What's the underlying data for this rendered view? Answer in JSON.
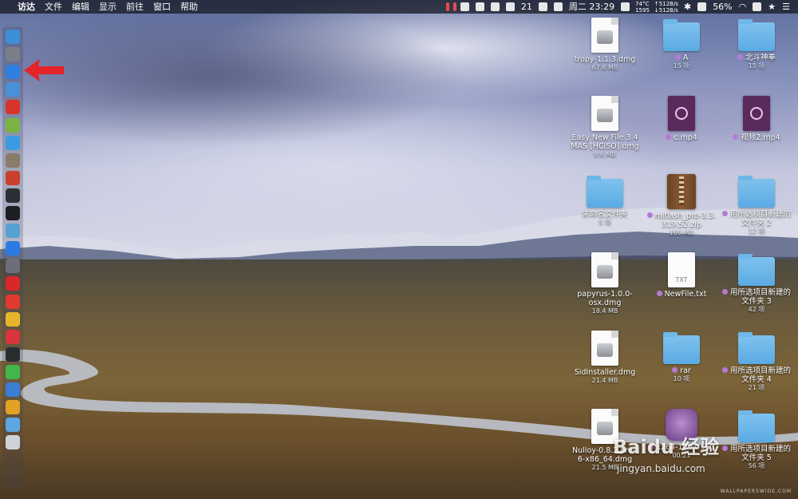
{
  "menubar": {
    "apple": "",
    "app_name": "访达",
    "menus": [
      "文件",
      "编辑",
      "显示",
      "前往",
      "窗口",
      "帮助"
    ],
    "status": {
      "wechat_count": "21",
      "datetime": "周二 23:29",
      "cpu_temp": "74°C",
      "fan_rpm": "1595",
      "net_up": "↑512B/s",
      "net_down": "↓512B/s",
      "battery": "56%"
    }
  },
  "dock": {
    "items": [
      {
        "name": "finder-icon",
        "color": "#3d8fd8",
        "glyph": ""
      },
      {
        "name": "launchpad-icon",
        "color": "#7b7f8a",
        "glyph": ""
      },
      {
        "name": "safari-icon",
        "color": "#2f7fe0",
        "glyph": ""
      },
      {
        "name": "contacts-icon",
        "color": "#4a90d9",
        "glyph": ""
      },
      {
        "name": "netease-icon",
        "color": "#d8342c",
        "glyph": ""
      },
      {
        "name": "android-icon",
        "color": "#7bb342",
        "glyph": ""
      },
      {
        "name": "migration-icon",
        "color": "#3a9ce0",
        "glyph": ""
      },
      {
        "name": "disk-icon",
        "color": "#8a7b6a",
        "glyph": ""
      },
      {
        "name": "music-icon",
        "color": "#c8402a",
        "glyph": ""
      },
      {
        "name": "activity-monitor-icon",
        "color": "#2b2f36",
        "glyph": ""
      },
      {
        "name": "terminal-icon",
        "color": "#1d1f22",
        "glyph": ""
      },
      {
        "name": "network-icon",
        "color": "#56a0d3",
        "glyph": ""
      },
      {
        "name": "app-store-icon",
        "color": "#2c7be5",
        "glyph": ""
      },
      {
        "name": "system-preferences-icon",
        "color": "#6b6f77",
        "glyph": ""
      },
      {
        "name": "weibo-icon",
        "color": "#d8282a",
        "glyph": ""
      },
      {
        "name": "yandex-icon",
        "color": "#e03a2e",
        "glyph": ""
      },
      {
        "name": "chrome-icon",
        "color": "#e8b52a",
        "glyph": ""
      },
      {
        "name": "vivaldi-icon",
        "color": "#d7363c",
        "glyph": ""
      },
      {
        "name": "terminal-alt-icon",
        "color": "#2a2d30",
        "glyph": ""
      },
      {
        "name": "wechat-icon",
        "color": "#44b549",
        "glyph": ""
      },
      {
        "name": "windows-vm-icon",
        "color": "#3a7fd4",
        "glyph": ""
      },
      {
        "name": "windows-logo-icon",
        "color": "#e3a126",
        "glyph": ""
      },
      {
        "name": "downloads-folder-icon",
        "color": "#5aa7e2",
        "glyph": ""
      },
      {
        "name": "trash-icon",
        "color": "#cfd3d8",
        "glyph": ""
      }
    ]
  },
  "desktop": {
    "items": [
      {
        "kind": "dmg",
        "name": "tropy-1.1.3.dmg",
        "sub": "67.6 MB",
        "tag": ""
      },
      {
        "kind": "folder",
        "name": "A",
        "sub": "15 项",
        "tag": "#b57bd6"
      },
      {
        "kind": "folder",
        "name": "北斗神拳",
        "sub": "15 项",
        "tag": "#b57bd6"
      },
      {
        "kind": "dmg",
        "name": "Easy New File 3.4\nMAS [HCiSO].dmg",
        "sub": "9.6 MB",
        "tag": ""
      },
      {
        "kind": "mp4",
        "name": "c.mp4",
        "sub": "",
        "tag": "#b57bd6"
      },
      {
        "kind": "mp4",
        "name": "视频2.mp4",
        "sub": "",
        "tag": "#b57bd6"
      },
      {
        "kind": "folder",
        "name": "未命名文件夹",
        "sub": "5 项",
        "tag": ""
      },
      {
        "kind": "zip",
        "name": "miflash_pro-3.3.\n319.52.zip",
        "sub": "108 MB",
        "tag": "#b57bd6"
      },
      {
        "kind": "folder",
        "name": "用所选项目新建的\n文件夹 2",
        "sub": "12 项",
        "tag": "#b57bd6"
      },
      {
        "kind": "dmg",
        "name": "papyrus-1.0.0-\nosx.dmg",
        "sub": "18.4 MB",
        "tag": ""
      },
      {
        "kind": "txt",
        "name": "NewFile.txt",
        "sub": "",
        "tag": "#b57bd6"
      },
      {
        "kind": "folder",
        "name": "用所选项目新建的\n文件夹 3",
        "sub": "42 项",
        "tag": "#b57bd6"
      },
      {
        "kind": "dmg",
        "name": "SidInstaller.dmg",
        "sub": "21.4 MB",
        "tag": ""
      },
      {
        "kind": "folder",
        "name": "rar",
        "sub": "10 项",
        "tag": "#b57bd6"
      },
      {
        "kind": "folder",
        "name": "用所选项目新建的\n文件夹 4",
        "sub": "21 项",
        "tag": "#b57bd6"
      },
      {
        "kind": "dmg",
        "name": "Nulloy-0.8.2.pre4\n6-x86_64.dmg",
        "sub": "21.5 MB",
        "tag": ""
      },
      {
        "kind": "app",
        "name": "x264-10bit-560",
        "sub": "00:21",
        "tag": "#b57bd6"
      },
      {
        "kind": "folder",
        "name": "用所选项目新建的\n文件夹 5",
        "sub": "56 项",
        "tag": "#b57bd6"
      }
    ]
  },
  "watermark": {
    "baidu": "Baidu 经验",
    "url": "jingyan.baidu.com",
    "credit": "WALLPAPERSWIDE.COM"
  }
}
